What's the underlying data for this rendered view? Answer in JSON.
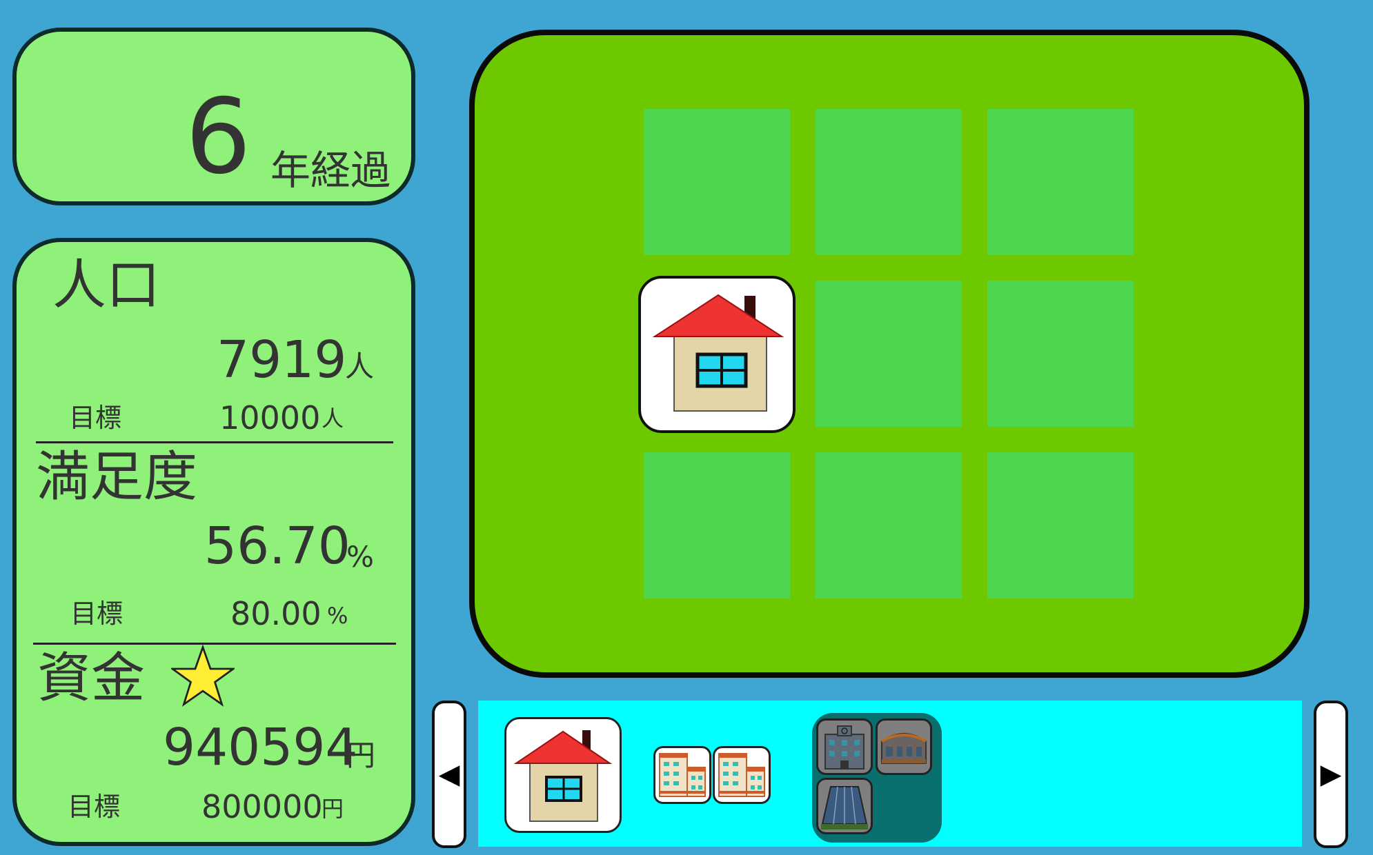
{
  "year": {
    "value": "6",
    "unit": "年経過"
  },
  "population": {
    "label": "人口",
    "value": "7919",
    "unit": "人",
    "goal_label": "目標",
    "goal_value": "10000",
    "goal_unit": "人"
  },
  "satisfaction": {
    "label": "満足度",
    "value": "56.70",
    "unit": "%",
    "goal_label": "目標",
    "goal_value": "80.00",
    "goal_unit": "%"
  },
  "funds": {
    "label": "資金",
    "star_icon": "star-icon",
    "value": "940594",
    "unit": "円",
    "goal_label": "目標",
    "goal_value": "800000",
    "goal_unit": "円"
  },
  "map": {
    "grid": [
      [
        "empty",
        "empty",
        "empty"
      ],
      [
        "house",
        "empty",
        "empty"
      ],
      [
        "empty",
        "empty",
        "empty"
      ]
    ]
  },
  "tray": {
    "left_arrow": "◀",
    "right_arrow": "▶",
    "items": [
      "house-icon",
      "apartment-icon",
      "apartment-icon",
      "office-building-icon",
      "school-building-icon",
      "solar-panel-icon"
    ]
  },
  "colors": {
    "background": "#3fa6d4",
    "panel": "#8ff179",
    "map": "#6ec800",
    "tile": "#4dd650",
    "tray": "#00ffff",
    "roof": "#ee3333",
    "star": "#ffee33"
  }
}
